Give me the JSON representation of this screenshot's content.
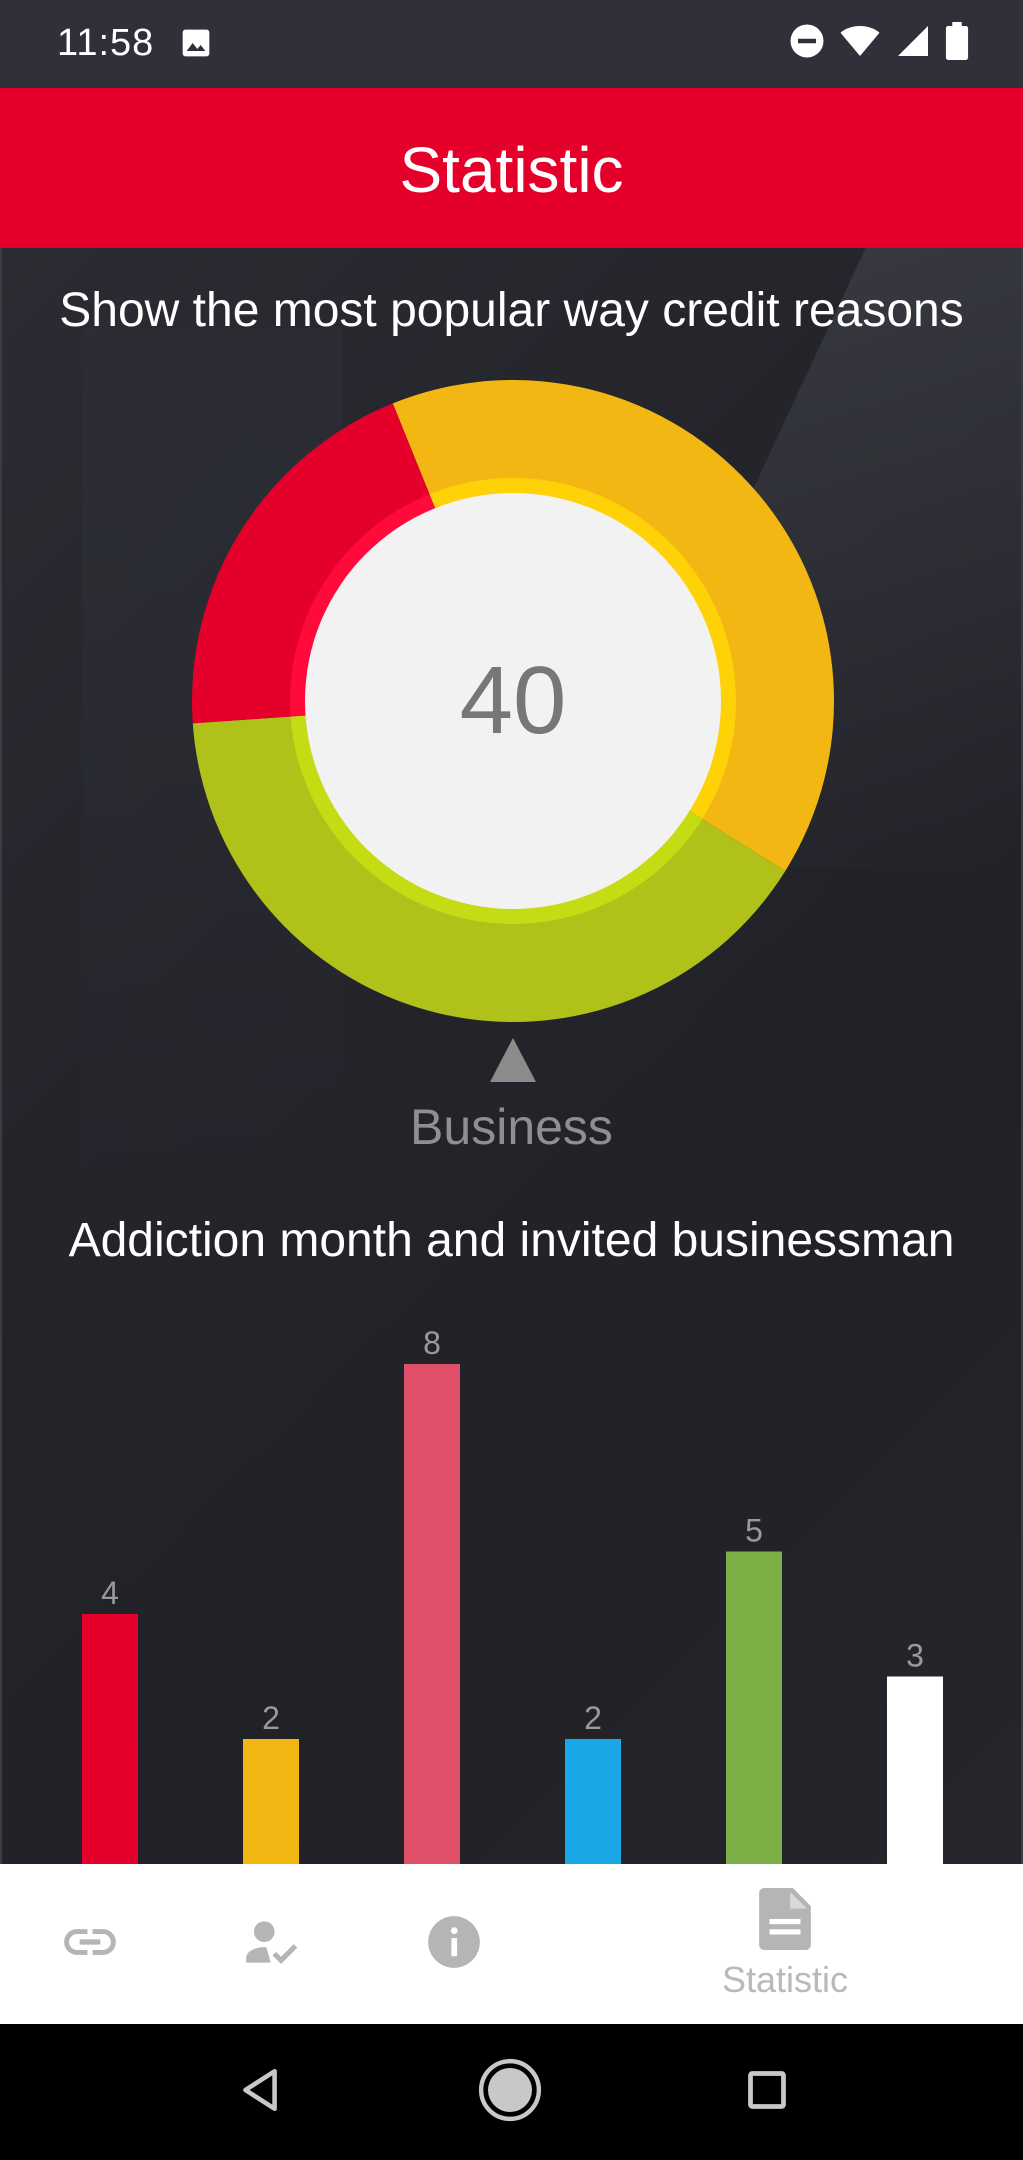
{
  "status_bar": {
    "time": "11:58",
    "icons": [
      "image-icon",
      "do-not-disturb-icon",
      "wifi-icon",
      "signal-icon",
      "battery-icon"
    ]
  },
  "app_bar": {
    "title": "Statistic",
    "color": "#e5002b"
  },
  "donut": {
    "title": "Show the most popular way credit reasons",
    "center_value": "40",
    "selected_label": "Business"
  },
  "bar_section": {
    "title": "Addiction month and invited businessman"
  },
  "chart_data": [
    {
      "type": "pie",
      "title": "Show the most popular way credit reasons",
      "center_value": "40",
      "selected": "Business",
      "values": [
        40,
        40,
        20
      ],
      "colors": [
        "#f2b712",
        "#b0c21a",
        "#e5002b"
      ],
      "inner_colors": [
        "#ffd208",
        "#c5db14",
        "#ff0a3a"
      ]
    },
    {
      "type": "bar",
      "title": "Addiction month and invited businessman",
      "categories": [],
      "values": [
        4,
        2,
        8,
        2,
        5,
        3
      ],
      "colors": [
        "#e5002b",
        "#f2b712",
        "#e1506a",
        "#1aa7e6",
        "#7cb046",
        "#ffffff"
      ],
      "ylim": [
        0,
        8
      ]
    }
  ],
  "bottom_nav": {
    "items": [
      {
        "icon": "link-icon"
      },
      {
        "icon": "person-check-icon"
      },
      {
        "icon": "info-icon"
      },
      {
        "icon": "document-icon",
        "label": "Statistic"
      }
    ]
  },
  "system_nav": {
    "icons": [
      "back-icon",
      "home-icon",
      "recents-icon"
    ]
  }
}
